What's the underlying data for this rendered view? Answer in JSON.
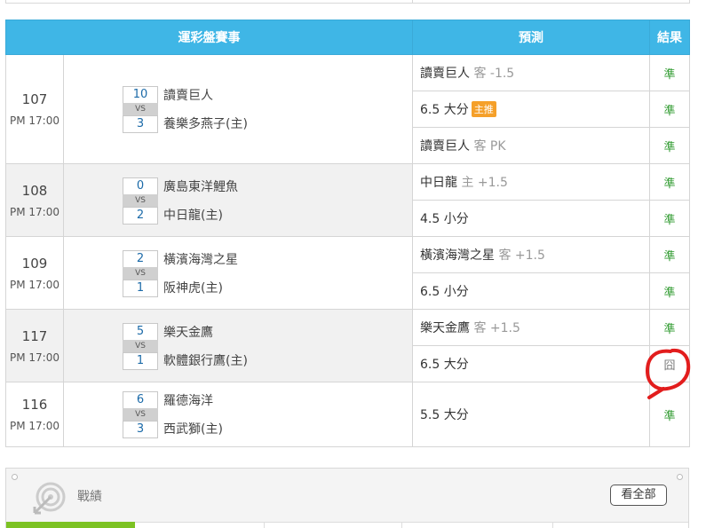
{
  "header": {
    "event": "運彩盤賽事",
    "prediction": "預測",
    "result": "結果"
  },
  "games": [
    {
      "no": "107",
      "time": "PM 17:00",
      "score1": "10",
      "team1": "讀賣巨人",
      "vs": "VS",
      "score2": "3",
      "team2": "養樂多燕子(主)",
      "preds": [
        {
          "main": "讀賣巨人",
          "side": " 客 -1.5",
          "badge": "",
          "result": "準"
        },
        {
          "main": "6.5 大分",
          "side": "",
          "badge": "主推",
          "result": "準"
        },
        {
          "main": "讀賣巨人",
          "side": " 客 PK",
          "badge": "",
          "result": "準"
        }
      ]
    },
    {
      "no": "108",
      "time": "PM 17:00",
      "score1": "0",
      "team1": "廣島東洋鯉魚",
      "vs": "VS",
      "score2": "2",
      "team2": "中日龍(主)",
      "preds": [
        {
          "main": "中日龍",
          "side": " 主 +1.5",
          "badge": "",
          "result": "準"
        },
        {
          "main": "4.5 小分",
          "side": "",
          "badge": "",
          "result": "準"
        }
      ]
    },
    {
      "no": "109",
      "time": "PM 17:00",
      "score1": "2",
      "team1": "橫濱海灣之星",
      "vs": "VS",
      "score2": "1",
      "team2": "阪神虎(主)",
      "preds": [
        {
          "main": "橫濱海灣之星",
          "side": " 客 +1.5",
          "badge": "",
          "result": "準"
        },
        {
          "main": "6.5 小分",
          "side": "",
          "badge": "",
          "result": "準"
        }
      ]
    },
    {
      "no": "117",
      "time": "PM 17:00",
      "score1": "5",
      "team1": "樂天金鷹",
      "vs": "VS",
      "score2": "1",
      "team2": "軟體銀行鷹(主)",
      "preds": [
        {
          "main": "樂天金鷹",
          "side": " 客 +1.5",
          "badge": "",
          "result": "準"
        },
        {
          "main": "6.5 大分",
          "side": "",
          "badge": "",
          "result": "囧"
        }
      ]
    },
    {
      "no": "116",
      "time": "PM 17:00",
      "score1": "6",
      "team1": "羅德海洋",
      "vs": "VS",
      "score2": "3",
      "team2": "西武獅(主)",
      "preds": [
        {
          "main": "5.5 大分",
          "side": "",
          "badge": "",
          "result": "準"
        }
      ]
    }
  ],
  "record": {
    "title": "戰績",
    "see_all": "看全部"
  },
  "colors": {
    "header": "#3fb6e6",
    "win": "#2e9a2e",
    "badge": "#f5a02a",
    "annotation": "#e21d1d",
    "tab": "#7cc223"
  },
  "icons": {
    "record": "target-arrow-icon"
  }
}
